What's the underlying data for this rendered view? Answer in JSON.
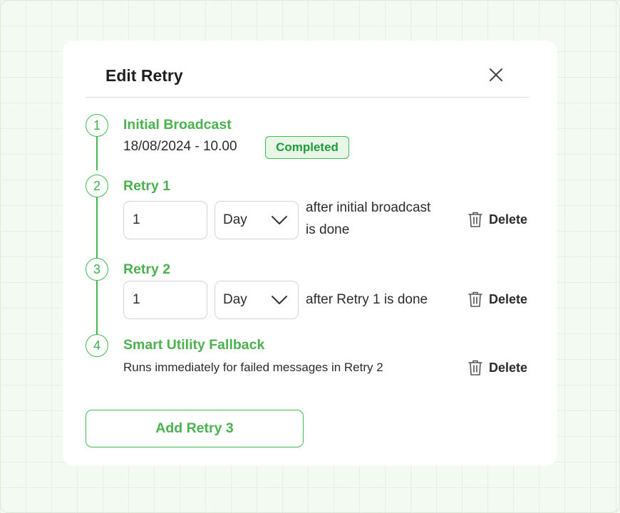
{
  "modal": {
    "title": "Edit Retry",
    "close_icon": "close-icon"
  },
  "steps": [
    {
      "number": "1",
      "title": "Initial Broadcast",
      "datetime": "18/08/2024 - 10.00",
      "status": "Completed"
    },
    {
      "number": "2",
      "title": "Retry 1",
      "interval_value": "1",
      "interval_unit": "Day",
      "after_line1": "after initial broadcast",
      "after_line2": "is done",
      "delete_label": "Delete"
    },
    {
      "number": "3",
      "title": "Retry 2",
      "interval_value": "1",
      "interval_unit": "Day",
      "after_text": "after Retry 1 is done",
      "delete_label": "Delete"
    },
    {
      "number": "4",
      "title": "Smart Utility Fallback",
      "description": "Runs immediately for failed messages in Retry 2",
      "delete_label": "Delete"
    }
  ],
  "add_button": "Add Retry 3",
  "colors": {
    "accent": "#4cb050",
    "badge_bg": "#e7f6e6",
    "badge_text": "#1f9a3c"
  },
  "icons": [
    "close-icon",
    "chevron-down-icon",
    "trash-icon"
  ]
}
